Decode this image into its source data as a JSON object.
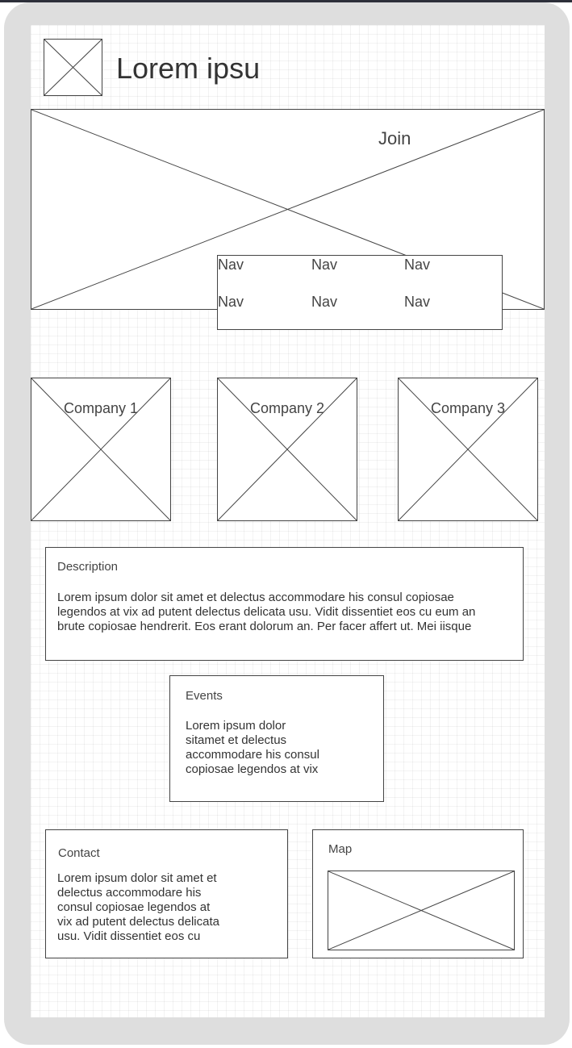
{
  "header": {
    "title": "Lorem ipsu"
  },
  "hero": {
    "join_label": "Join"
  },
  "nav": {
    "items": [
      "Nav",
      "Nav",
      "Nav",
      "Nav",
      "Nav",
      "Nav"
    ]
  },
  "companies": [
    "Company 1",
    "Company 2",
    "Company 3"
  ],
  "description": {
    "title": "Description",
    "lines": [
      "Lorem ipsum dolor sit amet et delectus accommodare his consul copiosae",
      "legendos at vix ad putent delectus delicata usu. Vidit dissentiet eos cu eum an",
      "brute copiosae hendrerit. Eos erant dolorum an. Per facer affert ut. Mei iisque"
    ]
  },
  "events": {
    "title": "Events",
    "lines": [
      "Lorem ipsum dolor",
      "sitamet et delectus",
      "accommodare his consul",
      "copiosae legendos at vix"
    ]
  },
  "contact": {
    "title": "Contact",
    "lines": [
      "Lorem ipsum dolor sit amet et",
      "delectus accommodare his",
      "consul copiosae legendos at",
      "vix ad putent delectus delicata",
      "usu. Vidit dissentiet eos cu"
    ]
  },
  "map": {
    "title": "Map"
  },
  "colors": {
    "stroke": "#444444",
    "frame": "#dedede",
    "top_bar": "#2d2f3a"
  }
}
